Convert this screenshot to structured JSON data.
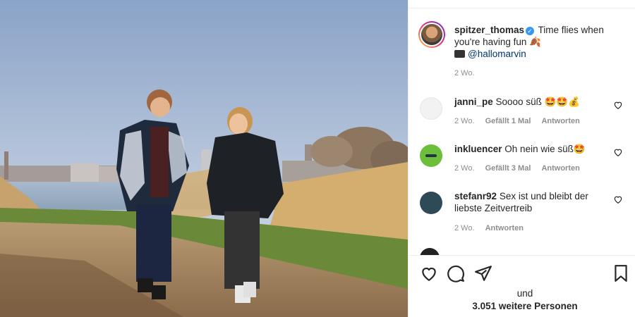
{
  "post": {
    "username": "spitzer_thomas",
    "caption": "Time flies when you're having fun",
    "mention": "@hallomarvin",
    "time": "2 Wo."
  },
  "comments": [
    {
      "username": "janni_pe",
      "text": "Soooo süß 🤩🤩💰",
      "time": "2 Wo.",
      "likes": "Gefällt 1 Mal",
      "reply": "Antworten",
      "avatar_color": "#f2f2f2"
    },
    {
      "username": "inkluencer",
      "text": "Oh nein wie süß🤩",
      "time": "2 Wo.",
      "likes": "Gefällt 3 Mal",
      "reply": "Antworten",
      "avatar_color": "#6cbf3a"
    },
    {
      "username": "stefanr92",
      "text": "Sex ist und bleibt der liebste Zeitvertreib",
      "time": "2 Wo.",
      "likes": "",
      "reply": "Antworten",
      "avatar_color": "#2f4a57"
    }
  ],
  "likes_summary": {
    "line1": "und",
    "line2": "3.051 weitere Personen"
  },
  "icons": {
    "like": "heart-icon",
    "comment": "comment-icon",
    "share": "share-icon",
    "save": "bookmark-icon",
    "verified": "verified-badge-icon"
  },
  "colors": {
    "verified": "#3897f0",
    "mention": "#00376b",
    "meta": "#8e8e8e"
  }
}
